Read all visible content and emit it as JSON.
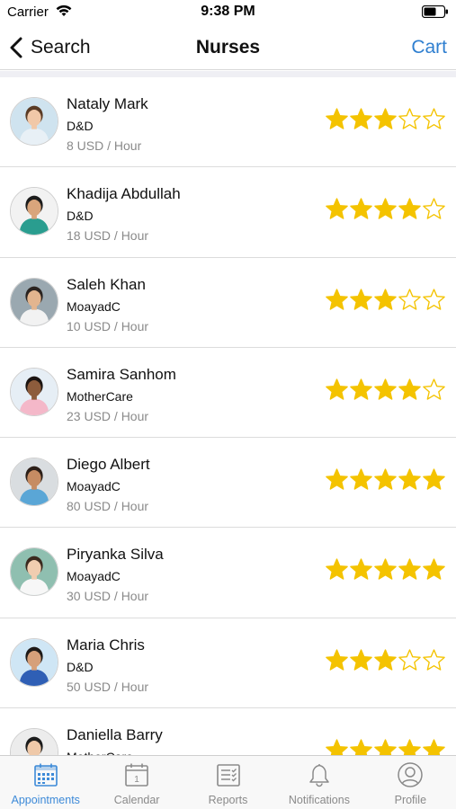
{
  "status_bar": {
    "carrier": "Carrier",
    "time": "9:38 PM"
  },
  "nav": {
    "back_label": "Search",
    "title": "Nurses",
    "cart_label": "Cart"
  },
  "colors": {
    "accent": "#3d8ad8",
    "star_fill": "#f4c300",
    "star_outline": "#f4c300",
    "muted_text": "#8a8a8a"
  },
  "nurses": [
    {
      "name": "Nataly Mark",
      "org": "D&D",
      "rate": "8 USD / Hour",
      "rating": 3
    },
    {
      "name": "Khadija Abdullah",
      "org": "D&D",
      "rate": "18 USD / Hour",
      "rating": 4
    },
    {
      "name": "Saleh Khan",
      "org": "MoayadC",
      "rate": "10 USD / Hour",
      "rating": 3
    },
    {
      "name": "Samira Sanhom",
      "org": "MotherCare",
      "rate": "23 USD / Hour",
      "rating": 4
    },
    {
      "name": "Diego Albert",
      "org": "MoayadC",
      "rate": "80 USD / Hour",
      "rating": 5
    },
    {
      "name": "Piryanka Silva",
      "org": "MoayadC",
      "rate": "30 USD / Hour",
      "rating": 5
    },
    {
      "name": "Maria Chris",
      "org": "D&D",
      "rate": "50 USD / Hour",
      "rating": 3
    },
    {
      "name": "Daniella Barry",
      "org": "MotherCare",
      "rate": "",
      "rating": 5
    }
  ],
  "tabs": [
    {
      "label": "Appointments",
      "icon": "calendar-grid-icon",
      "active": true
    },
    {
      "label": "Calendar",
      "icon": "calendar-day-icon",
      "active": false,
      "icon_text": "1"
    },
    {
      "label": "Reports",
      "icon": "report-list-icon",
      "active": false
    },
    {
      "label": "Notifications",
      "icon": "bell-icon",
      "active": false
    },
    {
      "label": "Profile",
      "icon": "profile-icon",
      "active": false
    }
  ]
}
